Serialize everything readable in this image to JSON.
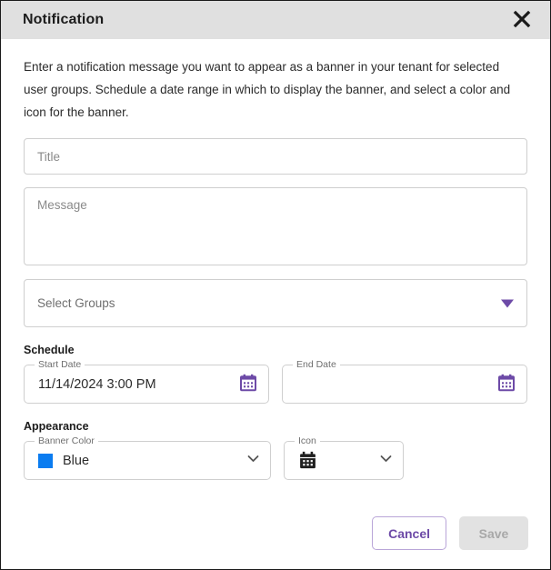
{
  "dialog": {
    "title": "Notification",
    "close_icon": "close-icon",
    "description": "Enter a notification message you want to appear as a banner in your tenant for selected user groups. Schedule a date range in which to display the banner, and select a color and icon for the banner."
  },
  "form": {
    "title_field": {
      "placeholder": "Title",
      "value": ""
    },
    "message_field": {
      "placeholder": "Message",
      "value": ""
    },
    "groups_field": {
      "placeholder": "Select Groups",
      "value": "",
      "arrow_icon": "caret-down-icon"
    }
  },
  "schedule": {
    "heading": "Schedule",
    "start_date": {
      "label": "Start Date",
      "value": "11/14/2024 3:00 PM",
      "icon": "calendar-icon"
    },
    "end_date": {
      "label": "End Date",
      "value": "",
      "icon": "calendar-icon"
    }
  },
  "appearance": {
    "heading": "Appearance",
    "banner_color": {
      "label": "Banner Color",
      "value": "Blue",
      "swatch_color": "#0a7cf0",
      "chevron_icon": "chevron-down-icon"
    },
    "icon_select": {
      "label": "Icon",
      "value": "calendar-icon",
      "chevron_icon": "chevron-down-icon"
    }
  },
  "footer": {
    "cancel_label": "Cancel",
    "save_label": "Save"
  },
  "colors": {
    "accent_purple": "#6d4aa7",
    "header_background": "#e0e0e0",
    "banner_blue": "#0a7cf0"
  }
}
